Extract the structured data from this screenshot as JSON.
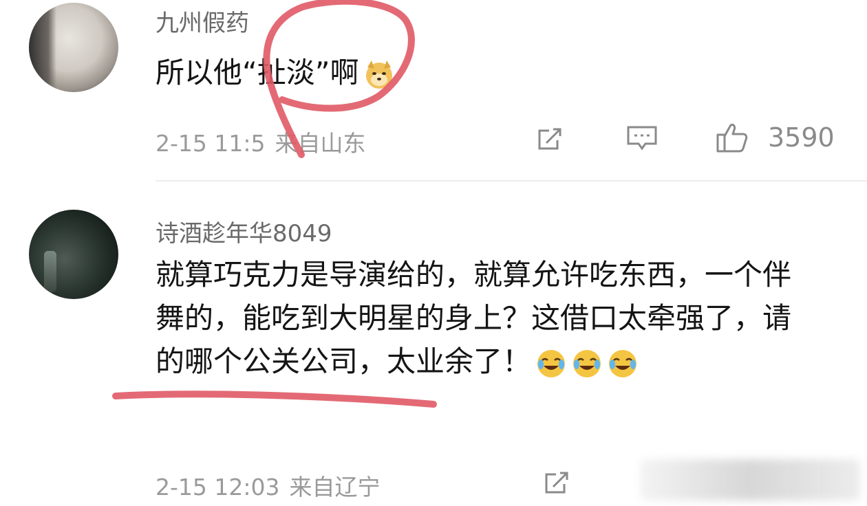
{
  "comments": [
    {
      "username": "九州假药",
      "text": "所以他“扯淡”啊",
      "emoji": "doge-emoji",
      "date": "2-15 11:5",
      "location": "来自山东",
      "likes": "3590"
    },
    {
      "username": "诗酒趁年华8049",
      "text": "就算巧克力是导演给的，就算允许吃东西，一个伴舞的，能吃到大明星的身上？这借口太牵强了，请的哪个公关公司，太业余了！",
      "emoji": "laugh-cry-emoji",
      "date": "2-15 12:03",
      "location": "来自辽宁",
      "likes": ""
    }
  ],
  "annotation_color": "#e05a66",
  "icons": [
    "share-icon",
    "comment-icon",
    "thumbs-up-icon"
  ]
}
